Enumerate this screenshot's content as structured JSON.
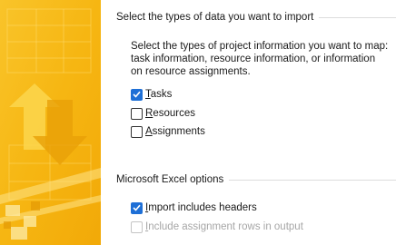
{
  "import_types": {
    "heading": "Select the types of data you want to import",
    "description": "Select the types of project information you want to map: task information, resource information, or information on resource assignments.",
    "options": [
      {
        "key_letter": "T",
        "rest": "asks",
        "checked": true,
        "enabled": true
      },
      {
        "key_letter": "R",
        "rest": "esources",
        "checked": false,
        "enabled": true
      },
      {
        "key_letter": "A",
        "rest": "ssignments",
        "checked": false,
        "enabled": true
      }
    ]
  },
  "excel_options": {
    "heading": "Microsoft Excel options",
    "options": [
      {
        "key_letter": "I",
        "rest": "mport includes headers",
        "checked": true,
        "enabled": true
      },
      {
        "key_letter": "I",
        "rest": "nclude assignment rows in output",
        "checked": false,
        "enabled": false
      }
    ]
  },
  "colors": {
    "banner_base": "#f6b612",
    "banner_light": "#fbd64e",
    "banner_dark": "#e49a05",
    "check_accent": "#1e6fd6"
  },
  "icons": {
    "banner": "wizard-banner-graphic",
    "checkmark": "checkmark-icon"
  }
}
